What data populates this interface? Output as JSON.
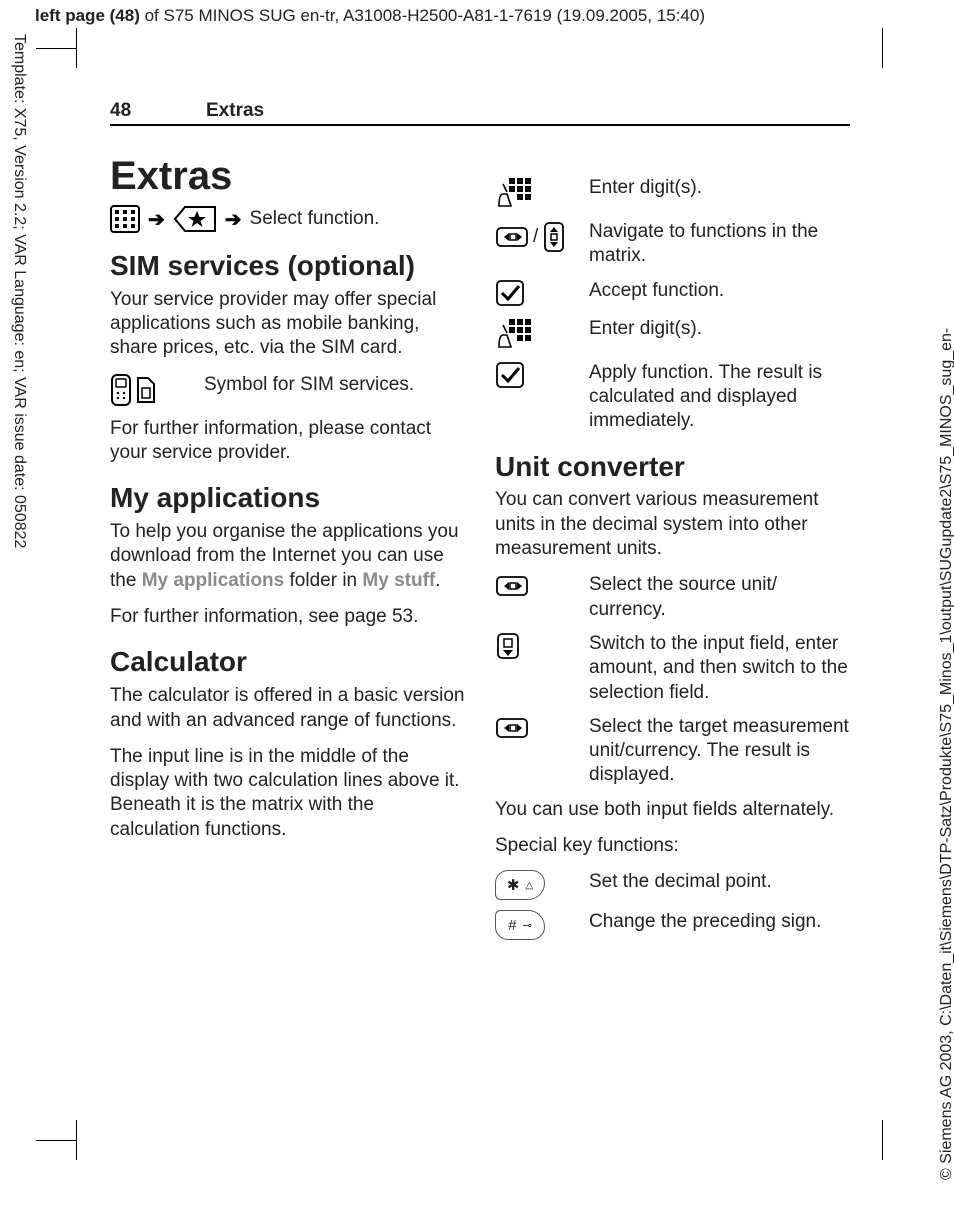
{
  "meta": {
    "top_prefix_bold": "left page (48)",
    "top_rest": " of S75 MINOS SUG en-tr, A31008-H2500-A81-1-7619 (19.09.2005, 15:40)",
    "side_left": "Template: X75, Version 2.2; VAR Language: en; VAR issue date: 050822",
    "side_right": "© Siemens AG 2003, C:\\Daten_it\\Siemens\\DTP-Satz\\Produkte\\S75_Minos_1\\output\\SUGupdate2\\S75_MINOS_sug_en-"
  },
  "header": {
    "page_number": "48",
    "running_title": "Extras"
  },
  "left": {
    "title": "Extras",
    "nav_select": "Select function.",
    "sim": {
      "heading": "SIM services (optional)",
      "p1": "Your service provider may offer special applications such as mobile banking, share prices, etc. via the SIM card.",
      "symbol_text": "Symbol for SIM services.",
      "p2": "For further information, please contact your service provider."
    },
    "apps": {
      "heading": "My applications",
      "p1a": "To help you organise the applications you download from the Internet you can use the ",
      "p1b": "My applications",
      "p1c": " folder in ",
      "p1d": "My stuff",
      "p1e": ".",
      "p2": "For further information, see page 53."
    },
    "calc": {
      "heading": "Calculator",
      "p1": "The calculator is offered in a basic version and with an advanced range of functions.",
      "p2": "The input line is in the middle of the display with two calculation lines above it. Beneath it is the matrix with the calculation functions."
    }
  },
  "right": {
    "calc_rows": {
      "r1": "Enter digit(s).",
      "r2": "Navigate to functions in the matrix.",
      "r3": "Accept function.",
      "r4": "Enter digit(s).",
      "r5": "Apply function. The result is calculated and displayed immediately."
    },
    "unit": {
      "heading": "Unit converter",
      "p1": "You can convert various measurement units in the decimal system into other measurement units.",
      "r1": "Select the source unit/ currency.",
      "r2": "Switch to the input field, enter amount, and then switch to the selection field.",
      "r3": "Select the target measurement unit/currency. The result is displayed.",
      "p2": "You can use both input fields alternately.",
      "p3": "Special key functions:",
      "k1": "Set the decimal point.",
      "k2": "Change the preceding sign."
    }
  }
}
